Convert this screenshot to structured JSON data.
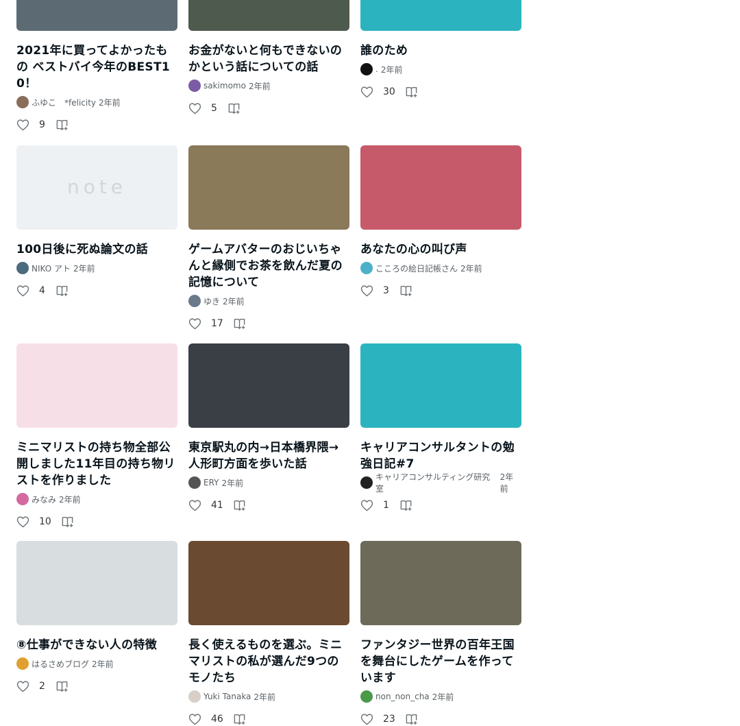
{
  "cards": [
    {
      "title": "2021年に買ってよかったもの ベストバイ今年のBEST10！",
      "author": "ふゆこ　*felicity",
      "age": "2年前",
      "likes": "9",
      "avatar_color": "#8a6d5a",
      "thumb_color": "#5c6b73"
    },
    {
      "title": "お金がないと何もできないのかという話についての話",
      "author": "sakimomo",
      "age": "2年前",
      "likes": "5",
      "avatar_color": "#7b5aa6",
      "thumb_color": "#4d5a4d"
    },
    {
      "title": "誰のため",
      "author": ".",
      "age": "2年前",
      "likes": "30",
      "avatar_color": "#111111",
      "thumb_color": "#2bb3c0"
    },
    {
      "title": "100日後に死ぬ論文の話",
      "author": "NIKO アト",
      "age": "2年前",
      "likes": "4",
      "avatar_color": "#4a6b80",
      "thumb_color": "#eef1f3",
      "thumb_text": "note"
    },
    {
      "title": "ゲームアバターのおじいちゃんと縁側でお茶を飲んだ夏の記憶について",
      "author": "ゆき",
      "age": "2年前",
      "likes": "17",
      "avatar_color": "#6a7a8a",
      "thumb_color": "#8a7a5a"
    },
    {
      "title": "あなたの心の叫び声",
      "author": "こころの絵日記帳さん",
      "age": "2年前",
      "likes": "3",
      "avatar_color": "#4cb0c8",
      "thumb_color": "#c65a6a"
    },
    {
      "title": "ミニマリストの持ち物全部公開しました11年目の持ち物リストを作りました",
      "author": "みなみ",
      "age": "2年前",
      "likes": "10",
      "avatar_color": "#d46aa0",
      "thumb_color": "#f7dfe7"
    },
    {
      "title": "東京駅丸の内→日本橋界隈→人形町方面を歩いた話",
      "author": "ERY",
      "age": "2年前",
      "likes": "41",
      "avatar_color": "#555555",
      "thumb_color": "#3a3f46"
    },
    {
      "title": "キャリアコンサルタントの勉強日記#7",
      "author": "キャリアコンサルティング研究室",
      "age": "2年前",
      "likes": "1",
      "avatar_color": "#222222",
      "thumb_color": "#2bb3c0"
    },
    {
      "title": "⑧仕事ができない人の特徴",
      "author": "はるさめブログ",
      "age": "2年前",
      "likes": "2",
      "avatar_color": "#e0a030",
      "thumb_color": "#d8dde0"
    },
    {
      "title": "長く使えるものを選ぶ。ミニマリストの私が選んだ9つのモノたち",
      "author": "Yuki Tanaka",
      "age": "2年前",
      "likes": "46",
      "avatar_color": "#d8d0c8",
      "thumb_color": "#6a4a30"
    },
    {
      "title": "ファンタジー世界の百年王国を舞台にしたゲームを作っています",
      "author": "non_non_cha",
      "age": "2年前",
      "likes": "23",
      "avatar_color": "#4a9a4a",
      "thumb_color": "#6d6a5a"
    }
  ],
  "colors": {
    "heart": "#6d7479",
    "bookmark": "#6d7479",
    "text": "#08131a"
  }
}
